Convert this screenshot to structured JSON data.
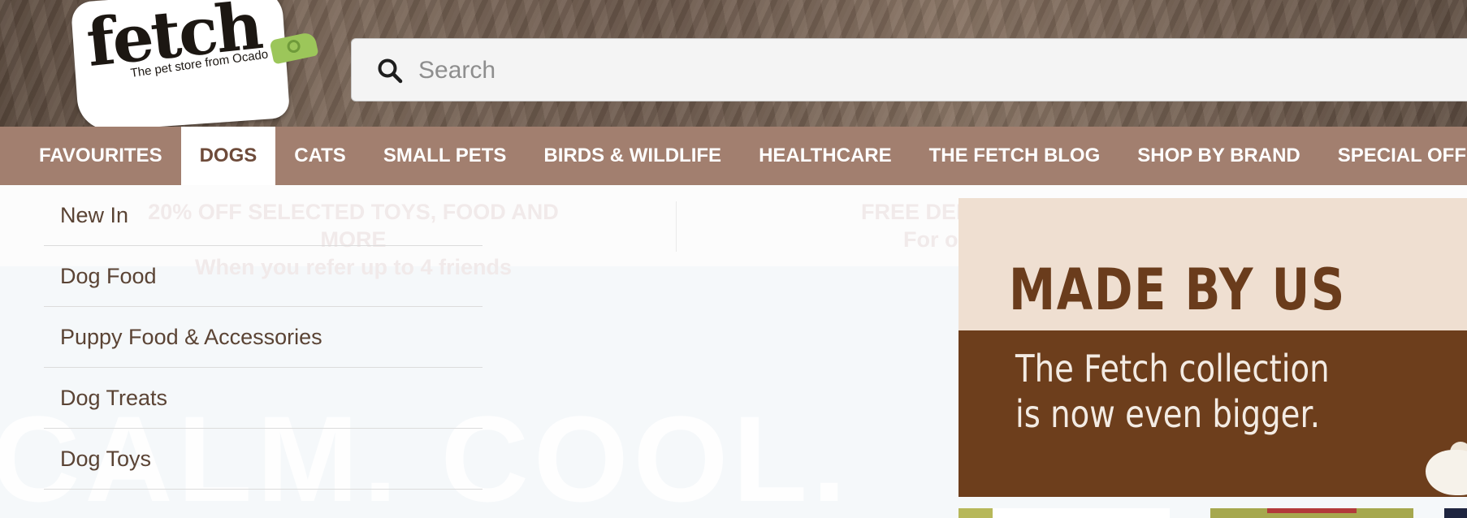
{
  "header": {
    "logo": {
      "wordmark": "fetch",
      "tagline": "The pet store from Ocado"
    },
    "search": {
      "placeholder": "Search",
      "icon": "search-icon"
    }
  },
  "nav": {
    "items": [
      {
        "label": "FAVOURITES"
      },
      {
        "label": "DOGS",
        "active": true
      },
      {
        "label": "CATS"
      },
      {
        "label": "SMALL PETS"
      },
      {
        "label": "BIRDS & WILDLIFE"
      },
      {
        "label": "HEALTHCARE"
      },
      {
        "label": "THE FETCH BLOG"
      },
      {
        "label": "SHOP BY BRAND"
      },
      {
        "label": "SPECIAL OFFERS"
      }
    ]
  },
  "promos": {
    "left_line1": "20% OFF SELECTED TOYS, FOOD AND MORE",
    "left_line2": "When you refer up to 4 friends",
    "right_line1": "FREE DELI",
    "right_line2": "For o"
  },
  "background_slogan": "CALM. COOL.",
  "dropdown": {
    "items": [
      {
        "label": "New In"
      },
      {
        "label": "Dog Food"
      },
      {
        "label": "Puppy Food & Accessories"
      },
      {
        "label": "Dog Treats"
      },
      {
        "label": "Dog Toys"
      }
    ]
  },
  "banner": {
    "title": "MADE BY US",
    "subtitle_line1": "The Fetch collection",
    "subtitle_line2": "is now even bigger."
  },
  "colors": {
    "nav_bg": "#a27f6f",
    "nav_active_text": "#6e4b3a",
    "banner_brown": "#6d3e1c",
    "banner_cream": "#efdfd1",
    "logo_green": "#9cc65a"
  }
}
